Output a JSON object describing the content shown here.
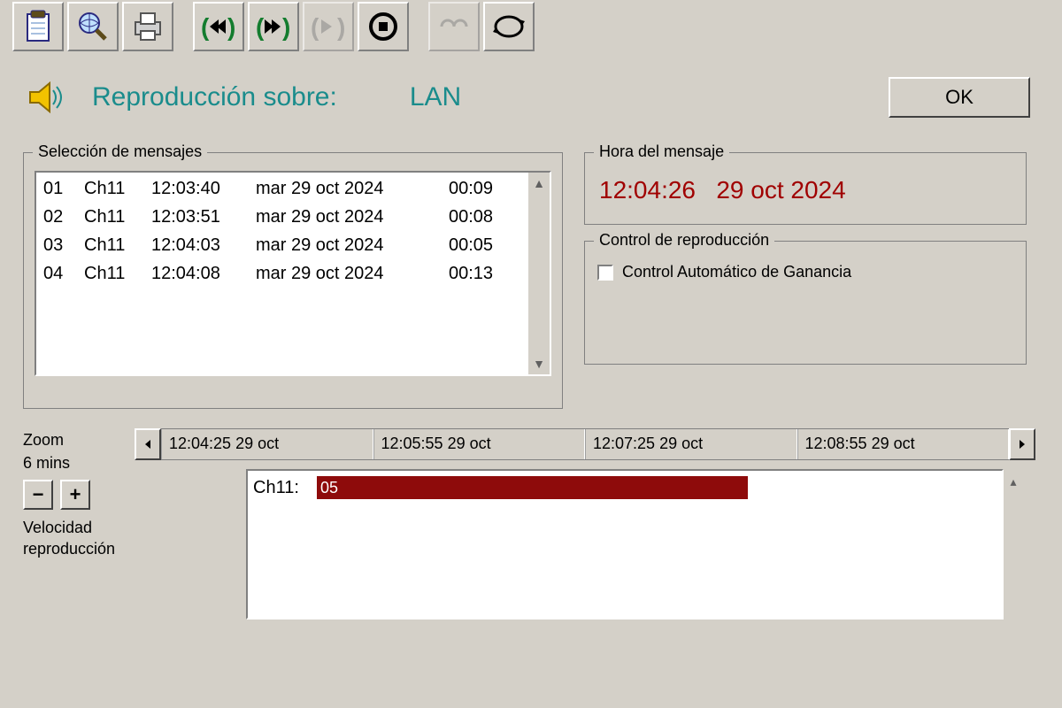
{
  "toolbar_icons": [
    "clipboard",
    "search-globe",
    "printer",
    "rewind",
    "fast-forward",
    "step-forward",
    "stop",
    "link",
    "refresh"
  ],
  "header": {
    "label": "Reproducción sobre:",
    "value": "LAN",
    "ok": "OK"
  },
  "groups": {
    "messages_title": "Selección de mensajes",
    "time_title": "Hora del mensaje",
    "control_title": "Control de reproducción"
  },
  "messages": [
    {
      "idx": "01",
      "ch": "Ch11",
      "time": "12:03:40",
      "date": "mar 29 oct 2024",
      "dur": "00:09",
      "selected": false
    },
    {
      "idx": "02",
      "ch": "Ch11",
      "time": "12:03:51",
      "date": "mar 29 oct 2024",
      "dur": "00:08",
      "selected": false
    },
    {
      "idx": "03",
      "ch": "Ch11",
      "time": "12:04:03",
      "date": "mar 29 oct 2024",
      "dur": "00:05",
      "selected": false
    },
    {
      "idx": "04",
      "ch": "Ch11",
      "time": "12:04:08",
      "date": "mar 29 oct 2024",
      "dur": "00:13",
      "selected": false
    },
    {
      "idx": "",
      "ch": "",
      "time": "",
      "date": "",
      "dur": "",
      "selected": true
    }
  ],
  "message_time": {
    "time": "12:04:26",
    "date": "29 oct 2024"
  },
  "control": {
    "agc_label": "Control Automático de Ganancia",
    "agc_checked": false
  },
  "zoom": {
    "label": "Zoom",
    "duration": "6 mins",
    "velocity_label": "Velocidad reproducción"
  },
  "ruler": [
    "12:04:25  29 oct",
    "12:05:55  29 oct",
    "12:07:25  29 oct",
    "12:08:55  29 oct"
  ],
  "track": {
    "channel": "Ch11:",
    "segment_label": "05",
    "segment_width_pct": 58
  }
}
